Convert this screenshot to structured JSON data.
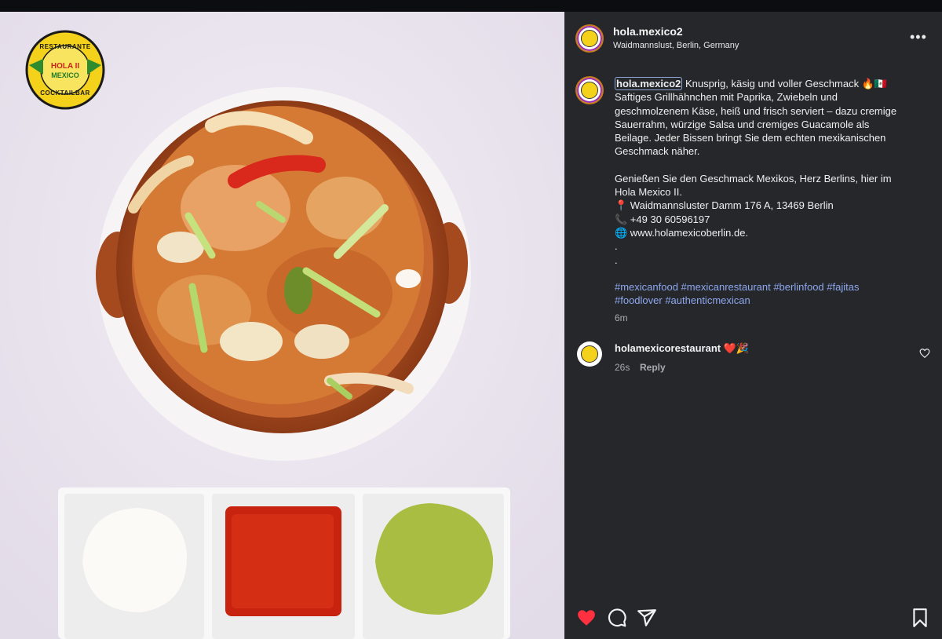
{
  "post": {
    "username": "hola.mexico2",
    "location": "Waidmannslust, Berlin, Germany",
    "caption_username": "hola.mexico2",
    "caption_lines": [
      " Knusprig, käsig und voller Geschmack 🔥🇲🇽",
      "Saftiges Grillhähnchen mit Paprika, Zwiebeln und",
      "geschmolzenem Käse, heiß und frisch serviert – dazu cremige",
      "Sauerrahm, würzige Salsa und cremiges Guacamole als",
      "Beilage. Jeder Bissen bringt Sie dem echten mexikanischen",
      "Geschmack näher.",
      "",
      "Genießen Sie den Geschmack Mexikos, Herz Berlins, hier im",
      "Hola Mexico II.",
      "📍 Waidmannsluster Damm 176 A, 13469 Berlin",
      "📞 +49 30 60596197",
      "🌐 www.holamexicoberlin.de.",
      ".",
      "."
    ],
    "hashtags_line1": "#mexicanfood #mexicanrestaurant #berlinfood #fajitas",
    "hashtags_line2": "#foodlover #authenticmexican",
    "time": "6m"
  },
  "logo": {
    "top_text": "RESTAURANTE",
    "bottom_text": "COCKTAILBAR",
    "name_line1": "HOLA II",
    "name_line2": "MEXICO"
  },
  "comment": {
    "username": "holamexicorestaurant",
    "emoji": " ❤️🎉",
    "time": "26s",
    "reply_label": "Reply"
  },
  "icons": {
    "like": "heart-icon",
    "comment": "comment-icon",
    "share": "share-icon",
    "save": "bookmark-icon",
    "more": "more-icon"
  },
  "colors": {
    "panel_bg": "#25272b",
    "hashtag": "#8ea7ee",
    "like_red": "#ff3040",
    "logo_yellow": "#f4d21c"
  }
}
